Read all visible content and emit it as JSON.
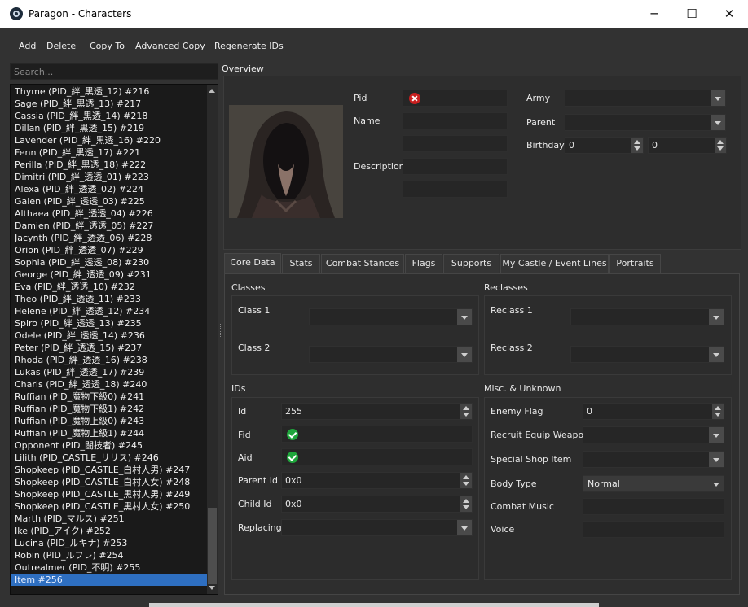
{
  "window": {
    "title": "Paragon - Characters",
    "minimize": "─",
    "maximize": "☐",
    "close": "✕"
  },
  "menu": {
    "add": "Add",
    "delete": "Delete",
    "copy_to": "Copy To",
    "advanced_copy": "Advanced Copy",
    "regenerate_ids": "Regenerate IDs"
  },
  "search": {
    "placeholder": "Search..."
  },
  "characters": [
    "Thyme (PID_絆_黒透_12) #216",
    "Sage (PID_絆_黒透_13) #217",
    "Cassia (PID_絆_黒透_14) #218",
    "Dillan (PID_絆_黒透_15) #219",
    "Lavender (PID_絆_黒透_16) #220",
    "Fenn (PID_絆_黒透_17) #221",
    "Perilla (PID_絆_黒透_18) #222",
    "Dimitri (PID_絆_透透_01) #223",
    "Alexa (PID_絆_透透_02) #224",
    "Galen (PID_絆_透透_03) #225",
    "Althaea (PID_絆_透透_04) #226",
    "Damien (PID_絆_透透_05) #227",
    "Jacynth (PID_絆_透透_06) #228",
    "Orion (PID_絆_透透_07) #229",
    "Sophia (PID_絆_透透_08) #230",
    "George (PID_絆_透透_09) #231",
    "Eva (PID_絆_透透_10) #232",
    "Theo (PID_絆_透透_11) #233",
    "Helene (PID_絆_透透_12) #234",
    "Spiro (PID_絆_透透_13) #235",
    "Odele (PID_絆_透透_14) #236",
    "Peter (PID_絆_透透_15) #237",
    "Rhoda (PID_絆_透透_16) #238",
    "Lukas (PID_絆_透透_17) #239",
    "Charis (PID_絆_透透_18) #240",
    "Ruffian (PID_魔物下級0) #241",
    "Ruffian (PID_魔物下級1) #242",
    "Ruffian (PID_魔物上級0) #243",
    "Ruffian (PID_魔物上級1) #244",
    "Opponent (PID_闘技者) #245",
    "Lilith (PID_CASTLE_リリス) #246",
    "Shopkeep (PID_CASTLE_白村人男) #247",
    "Shopkeep (PID_CASTLE_白村人女) #248",
    "Shopkeep (PID_CASTLE_黒村人男) #249",
    "Shopkeep (PID_CASTLE_黒村人女) #250",
    "Marth (PID_マルス) #251",
    "Ike (PID_アイク) #252",
    "Lucina (PID_ルキナ) #253",
    "Robin (PID_ルフレ) #254",
    "Outrealmer (PID_不明) #255",
    "Item #256"
  ],
  "selected_index": 40,
  "overview": {
    "section": "Overview",
    "pid_label": "Pid",
    "name_label": "Name",
    "description_label": "Description",
    "army_label": "Army",
    "parent_label": "Parent",
    "birthday_label": "Birthday",
    "birthday_month": "0",
    "birthday_day": "0"
  },
  "tabs": [
    "Core Data",
    "Stats",
    "Combat Stances",
    "Flags",
    "Supports",
    "My Castle / Event Lines",
    "Portraits"
  ],
  "core": {
    "classes_title": "Classes",
    "class1": "Class 1",
    "class2": "Class 2",
    "reclasses_title": "Reclasses",
    "reclass1": "Reclass 1",
    "reclass2": "Reclass 2",
    "ids_title": "IDs",
    "id_label": "Id",
    "id_value": "255",
    "fid_label": "Fid",
    "aid_label": "Aid",
    "parent_id_label": "Parent Id",
    "parent_id_value": "0x0",
    "child_id_label": "Child Id",
    "child_id_value": "0x0",
    "replacing_label": "Replacing",
    "misc_title": "Misc. & Unknown",
    "enemy_flag_label": "Enemy Flag",
    "enemy_flag_value": "0",
    "recruit_equip_label": "Recruit Equip Weapon",
    "special_shop_label": "Special Shop Item",
    "body_type_label": "Body Type",
    "body_type_value": "Normal",
    "combat_music_label": "Combat Music",
    "voice_label": "Voice"
  }
}
